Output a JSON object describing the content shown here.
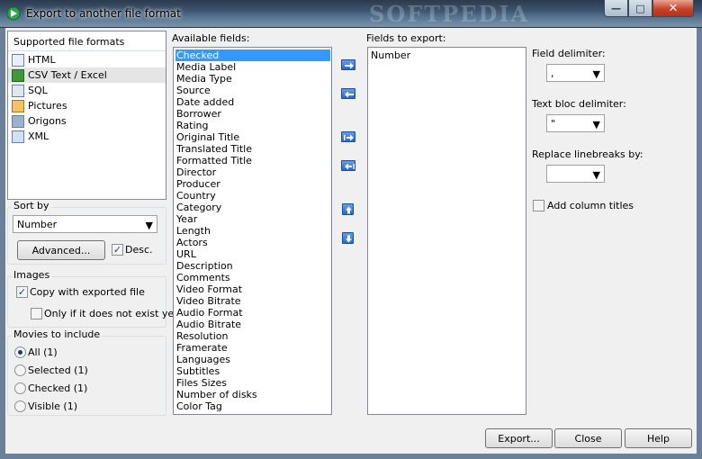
{
  "window": {
    "title": "Export to another file format"
  },
  "formats": {
    "header": "Supported file formats",
    "items": [
      {
        "label": "HTML",
        "icon": "html-file-icon"
      },
      {
        "label": "CSV Text / Excel",
        "icon": "excel-file-icon"
      },
      {
        "label": "SQL",
        "icon": "sql-file-icon"
      },
      {
        "label": "Pictures",
        "icon": "pictures-icon"
      },
      {
        "label": "Origons",
        "icon": "origons-icon"
      },
      {
        "label": "XML",
        "icon": "xml-file-icon"
      }
    ],
    "selected": "CSV Text / Excel"
  },
  "sort": {
    "label": "Sort by",
    "value": "Number",
    "advanced_label": "Advanced...",
    "desc_label": "Desc.",
    "desc_checked": true
  },
  "images": {
    "label": "Images",
    "copy_label": "Copy with exported file",
    "copy_checked": true,
    "only_label": "Only if it does not exist yet",
    "only_checked": false
  },
  "movies": {
    "label": "Movies to include",
    "options": [
      {
        "label": "All (1)",
        "checked": true
      },
      {
        "label": "Selected (1)",
        "checked": false
      },
      {
        "label": "Checked (1)",
        "checked": false
      },
      {
        "label": "Visible (1)",
        "checked": false
      }
    ]
  },
  "available": {
    "label": "Available fields:",
    "items": [
      "Checked",
      "Media Label",
      "Media Type",
      "Source",
      "Date added",
      "Borrower",
      "Rating",
      "Original Title",
      "Translated Title",
      "Formatted Title",
      "Director",
      "Producer",
      "Country",
      "Category",
      "Year",
      "Length",
      "Actors",
      "URL",
      "Description",
      "Comments",
      "Video Format",
      "Video Bitrate",
      "Audio Format",
      "Audio Bitrate",
      "Resolution",
      "Framerate",
      "Languages",
      "Subtitles",
      "Files Sizes",
      "Number of disks",
      "Color Tag"
    ],
    "selected": "Checked"
  },
  "export_fields": {
    "label": "Fields to export:",
    "items": [
      "Number"
    ]
  },
  "options": {
    "field_delimiter_label": "Field delimiter:",
    "field_delimiter_value": ",",
    "text_delimiter_label": "Text bloc delimiter:",
    "text_delimiter_value": "\"",
    "linebreaks_label": "Replace linebreaks by:",
    "linebreaks_value": "",
    "column_titles_label": "Add column titles",
    "column_titles_checked": false
  },
  "buttons": {
    "export": "Export...",
    "close": "Close",
    "help": "Help"
  },
  "watermark": "SOFTPEDIA",
  "colors": {
    "selection": "#3399ff",
    "title_gradient": "#3e5570"
  }
}
